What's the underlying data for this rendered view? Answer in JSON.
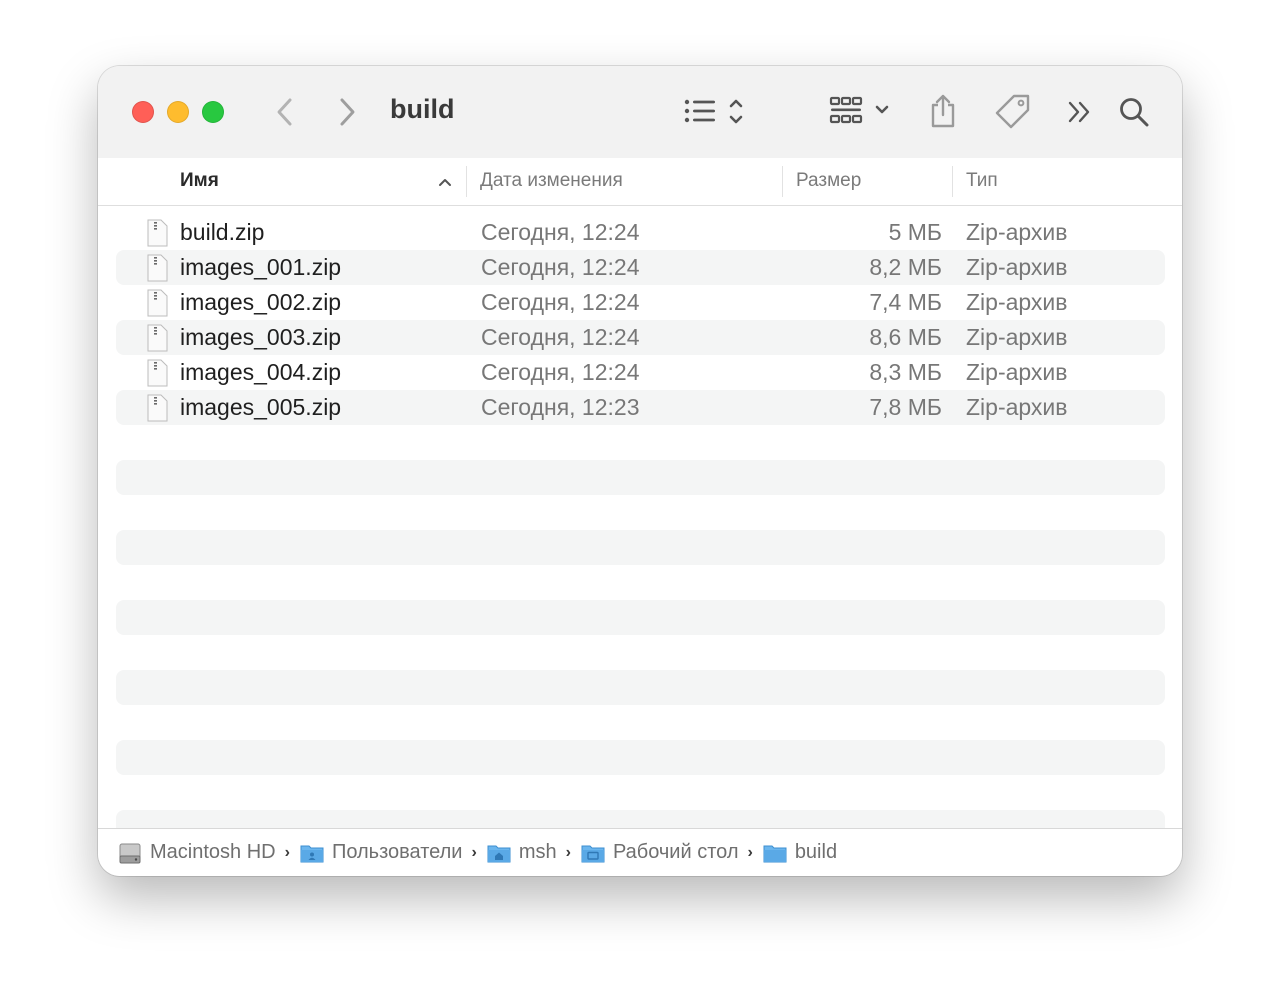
{
  "window": {
    "title": "build",
    "traffic_lights": {
      "close": "#ff5f57",
      "minimize": "#febc2e",
      "maximize": "#28c840"
    }
  },
  "toolbar": {
    "icons": [
      "back-icon",
      "forward-icon",
      "list-view-icon",
      "group-icon",
      "share-icon",
      "tag-icon",
      "more-icon",
      "search-icon"
    ]
  },
  "columns": {
    "name": "Имя",
    "date": "Дата изменения",
    "size": "Размер",
    "kind": "Тип"
  },
  "files": [
    {
      "name": "build.zip",
      "date": "Сегодня, 12:24",
      "size": "5 МБ",
      "kind": "Zip-архив"
    },
    {
      "name": "images_001.zip",
      "date": "Сегодня, 12:24",
      "size": "8,2 МБ",
      "kind": "Zip-архив"
    },
    {
      "name": "images_002.zip",
      "date": "Сегодня, 12:24",
      "size": "7,4 МБ",
      "kind": "Zip-архив"
    },
    {
      "name": "images_003.zip",
      "date": "Сегодня, 12:24",
      "size": "8,6 МБ",
      "kind": "Zip-архив"
    },
    {
      "name": "images_004.zip",
      "date": "Сегодня, 12:24",
      "size": "8,3 МБ",
      "kind": "Zip-архив"
    },
    {
      "name": "images_005.zip",
      "date": "Сегодня, 12:23",
      "size": "7,8 МБ",
      "kind": "Zip-архив"
    }
  ],
  "path": [
    {
      "label": "Macintosh HD",
      "icon": "hard-drive-icon"
    },
    {
      "label": "Пользователи",
      "icon": "users-folder-icon"
    },
    {
      "label": "msh",
      "icon": "home-folder-icon"
    },
    {
      "label": "Рабочий стол",
      "icon": "desktop-folder-icon"
    },
    {
      "label": "build",
      "icon": "folder-icon"
    }
  ],
  "colors": {
    "folder_blue": "#5aa9e6",
    "alt_row": "#f4f5f5"
  }
}
